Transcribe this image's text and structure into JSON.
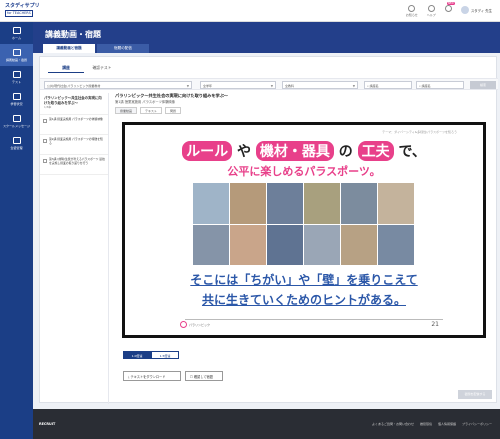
{
  "app": {
    "logo_line1": "スタディサプリ",
    "logo_line2": "for TEACHERS"
  },
  "topbar": {
    "icons": [
      {
        "label": "お知らせ",
        "icon": "bell-icon"
      },
      {
        "label": "ヘルプ",
        "icon": "help-icon"
      },
      {
        "label": "",
        "icon": "info-icon",
        "badge": "NEW"
      }
    ],
    "user": "スタディ 先生"
  },
  "sidebar": {
    "items": [
      {
        "label": "ホーム",
        "icon": "home-icon"
      },
      {
        "label": "講義動画・宿題",
        "icon": "video-icon"
      },
      {
        "label": "テスト",
        "icon": "test-icon"
      },
      {
        "label": "学習状況",
        "icon": "chart-icon"
      },
      {
        "label": "スクールメッセージ",
        "icon": "message-icon"
      },
      {
        "label": "生徒管理",
        "icon": "users-icon"
      }
    ]
  },
  "header": {
    "title": "講義動画・宿題",
    "tabs": [
      "講義動画と宿題",
      "宿題の配信"
    ]
  },
  "subtabs": [
    "講座",
    "確認テスト"
  ],
  "filters": {
    "course": "公共(現代社会)パラリンピック授業教材",
    "grade": "全学年",
    "subject": "全教科",
    "search1": "講座名",
    "search2": "講座名",
    "search_button": "検索"
  },
  "lesson_list": {
    "heading": "パラリンピック〜共生社会の実現に向けた取り組みを学ぶ〜",
    "sub": "1/8本",
    "items": [
      "第1講 授業実施用 パラスポーツの体験映像",
      "第2講 授業実施用 パラスポーツの特徴を知る",
      "第3講 (前時)生徒が考えるパラスポーツ 競技を実施し授業の振り返りを行う"
    ]
  },
  "content": {
    "title": "パラリンピック〜共生社会の実現に向けた取り組みを学ぶ〜",
    "subtitle": "第1講 授業実施用 パラスポーツ体験映像",
    "tabs": [
      "授業動画",
      "テキスト",
      "問題"
    ]
  },
  "slide": {
    "theme": "テーマ：ダイバーシティ&多様性/パラスポーツを知ろう",
    "w1": "ルール",
    "w2": "や",
    "w3": "機材・器具",
    "w4": "の",
    "w5": "工夫",
    "w6": "で、",
    "line2": "公平に楽しめるパラスポーツ。",
    "line3": "そこには「ちがい」や「壁」を乗りこえて",
    "line4": "共に生きていくためのヒントがある。",
    "logo": "パラリンピック",
    "page": "21"
  },
  "speed": [
    "1.0倍速",
    "1.5倍速"
  ],
  "buttons": {
    "download": "テキストをダウンロード",
    "share": "確認して宿題"
  },
  "bottom_button": "宿題を配信する",
  "footer": {
    "brand": "RECRUIT",
    "links": [
      "よくあるご質問・お問い合わせ",
      "推奨環境",
      "個人情報保護",
      "プライバシーポリシー"
    ]
  }
}
